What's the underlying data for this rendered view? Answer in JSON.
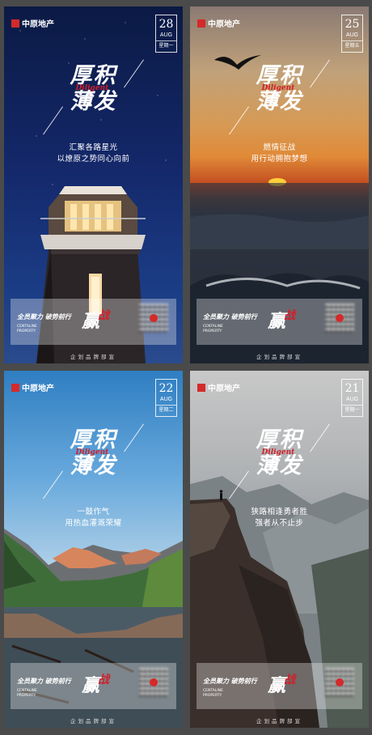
{
  "posters": [
    {
      "logo": "中原地产",
      "date": {
        "day": "28",
        "month": "AUG",
        "weekday": "星期一"
      },
      "title": [
        "厚积",
        "薄发"
      ],
      "script": "Diligent",
      "tagline": [
        "汇聚各路星光",
        "以燎原之势同心向前"
      ],
      "footer": {
        "slogan": "全员聚力 破势前行",
        "brush": "赢",
        "brush_red": "战",
        "sub": [
          "CENTALINE",
          "PROPERTY"
        ],
        "bottom": "企划品牌部宣"
      }
    },
    {
      "logo": "中原地产",
      "date": {
        "day": "25",
        "month": "AUG",
        "weekday": "星期五"
      },
      "title": [
        "厚积",
        "薄发"
      ],
      "script": "Diligent",
      "tagline": [
        "燃情征战",
        "用行动拥抱梦想"
      ],
      "footer": {
        "slogan": "全员聚力 破势前行",
        "brush": "赢",
        "brush_red": "战",
        "sub": [
          "CENTALINE",
          "PROPERTY"
        ],
        "bottom": "企划品牌部宣"
      }
    },
    {
      "logo": "中原地产",
      "date": {
        "day": "22",
        "month": "AUG",
        "weekday": "星期二"
      },
      "title": [
        "厚积",
        "薄发"
      ],
      "script": "Diligent",
      "tagline": [
        "一鼓作气",
        "用热血灌溉荣耀"
      ],
      "footer": {
        "slogan": "全员聚力 破势前行",
        "brush": "赢",
        "brush_red": "战",
        "sub": [
          "CENTALINE",
          "PROPERTY"
        ],
        "bottom": "企划品牌部宣"
      }
    },
    {
      "logo": "中原地产",
      "date": {
        "day": "21",
        "month": "AUG",
        "weekday": "星期一"
      },
      "title": [
        "厚积",
        "薄发"
      ],
      "script": "Diligent",
      "tagline": [
        "狭路相逢勇者胜",
        "强者从不止步"
      ],
      "footer": {
        "slogan": "全员聚力 破势前行",
        "brush": "赢",
        "brush_red": "战",
        "sub": [
          "CENTALINE",
          "PROPERTY"
        ],
        "bottom": "企划品牌部宣"
      }
    }
  ],
  "colors": {
    "brand_red": "#d42a2a",
    "script_red": "#d0202a"
  }
}
